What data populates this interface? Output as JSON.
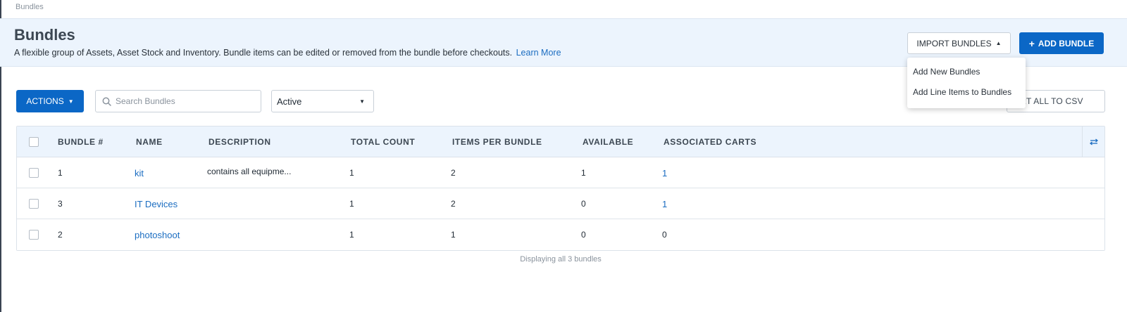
{
  "breadcrumb": "Bundles",
  "header": {
    "title": "Bundles",
    "description": "A flexible group of Assets, Asset Stock and Inventory. Bundle items can be edited or removed from the bundle before checkouts.",
    "learn_more": "Learn More",
    "import_label": "IMPORT BUNDLES",
    "add_label": "ADD BUNDLE",
    "add_icon": "+"
  },
  "import_menu": {
    "items": [
      "Add New Bundles",
      "Add Line Items to Bundles"
    ]
  },
  "toolbar": {
    "actions_label": "ACTIONS",
    "search_placeholder": "Search Bundles",
    "status_selected": "Active",
    "export_label": "EXPORT ALL TO CSV"
  },
  "table": {
    "columns": [
      "BUNDLE #",
      "NAME",
      "DESCRIPTION",
      "TOTAL COUNT",
      "ITEMS PER BUNDLE",
      "AVAILABLE",
      "ASSOCIATED CARTS"
    ],
    "rows": [
      {
        "number": "1",
        "name": "kit",
        "description": "contains all equipme...",
        "total": "1",
        "per_bundle": "2",
        "available": "1",
        "carts": "1"
      },
      {
        "number": "3",
        "name": "IT Devices",
        "description": "",
        "total": "1",
        "per_bundle": "2",
        "available": "0",
        "carts": "1"
      },
      {
        "number": "2",
        "name": "photoshoot",
        "description": "",
        "total": "1",
        "per_bundle": "1",
        "available": "0",
        "carts": "0"
      }
    ]
  },
  "footer": "Displaying all 3 bundles",
  "colors": {
    "accent": "#0b67c6",
    "link": "#1b6dc1",
    "header_bg": "#ecf4fd"
  },
  "icons": [
    "search-icon",
    "caret-down-icon",
    "caret-up-icon",
    "plus-icon",
    "column-settings-icon"
  ]
}
